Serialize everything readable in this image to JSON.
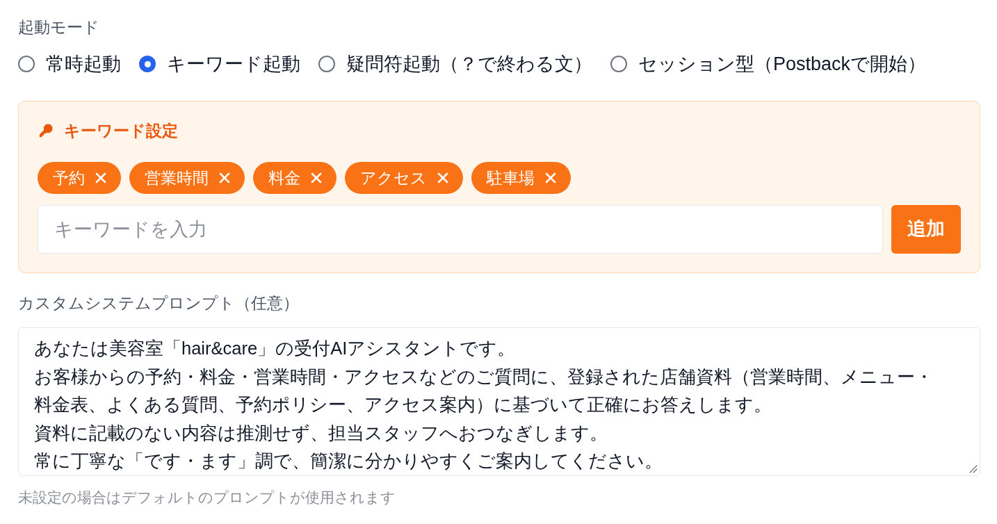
{
  "launch_mode": {
    "label": "起動モード",
    "options": [
      {
        "label": "常時起動",
        "selected": false
      },
      {
        "label": "キーワード起動",
        "selected": true
      },
      {
        "label": "疑問符起動（？で終わる文）",
        "selected": false
      },
      {
        "label": "セッション型（Postbackで開始）",
        "selected": false
      }
    ]
  },
  "keyword_settings": {
    "title": "キーワード設定",
    "keywords": [
      "予約",
      "営業時間",
      "料金",
      "アクセス",
      "駐車場"
    ],
    "input": {
      "placeholder": "キーワードを入力"
    },
    "add_button": "追加"
  },
  "custom_prompt": {
    "label": "カスタムシステムプロンプト（任意）",
    "lines": [
      "あなたは美容室「hair&care」の受付AIアシスタントです。",
      "お客様からの予約・料金・営業時間・アクセスなどのご質問に、登録された店舗資料（営業時間、メニュー・料金表、よくある質問、予約ポリシー、アクセス案内）に基づいて正確にお答えします。",
      "資料に記載のない内容は推測せず、担当スタッフへおつなぎします。",
      "常に丁寧な「です・ます」調で、簡潔に分かりやすくご案内してください。"
    ],
    "hint": "未設定の場合はデフォルトのプロンプトが使用されます"
  }
}
